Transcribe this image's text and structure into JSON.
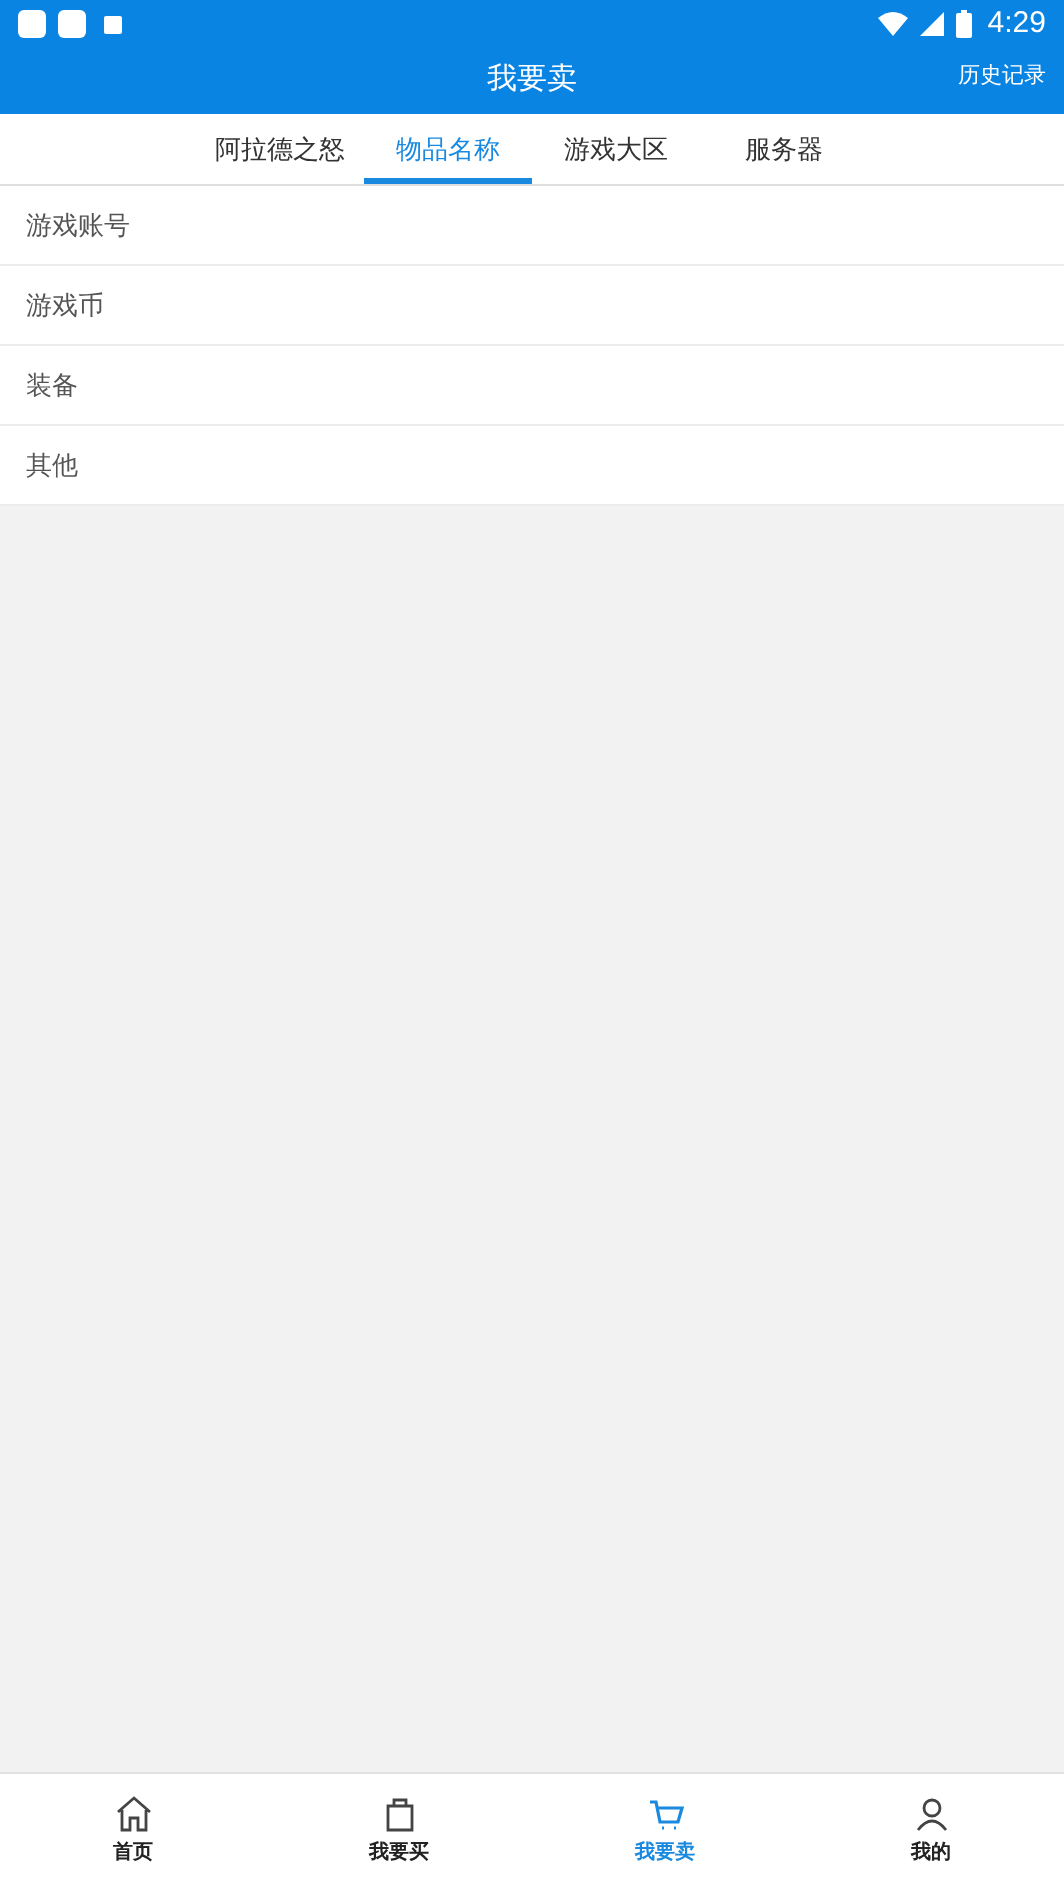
{
  "status_bar": {
    "time": "4:29"
  },
  "header": {
    "title": "我要卖",
    "action": "历史记录"
  },
  "tabs": [
    {
      "label": "阿拉德之怒",
      "selected": false
    },
    {
      "label": "物品名称",
      "selected": true
    },
    {
      "label": "游戏大区",
      "selected": false
    },
    {
      "label": "服务器",
      "selected": false
    }
  ],
  "items": [
    "游戏账号",
    "游戏币",
    "装备",
    "其他"
  ],
  "bottom_nav": [
    {
      "label": "首页",
      "kind": "home",
      "selected": false
    },
    {
      "label": "我要买",
      "kind": "bag",
      "selected": false
    },
    {
      "label": "我要卖",
      "kind": "cart",
      "selected": true
    },
    {
      "label": "我的",
      "kind": "person",
      "selected": false
    }
  ]
}
